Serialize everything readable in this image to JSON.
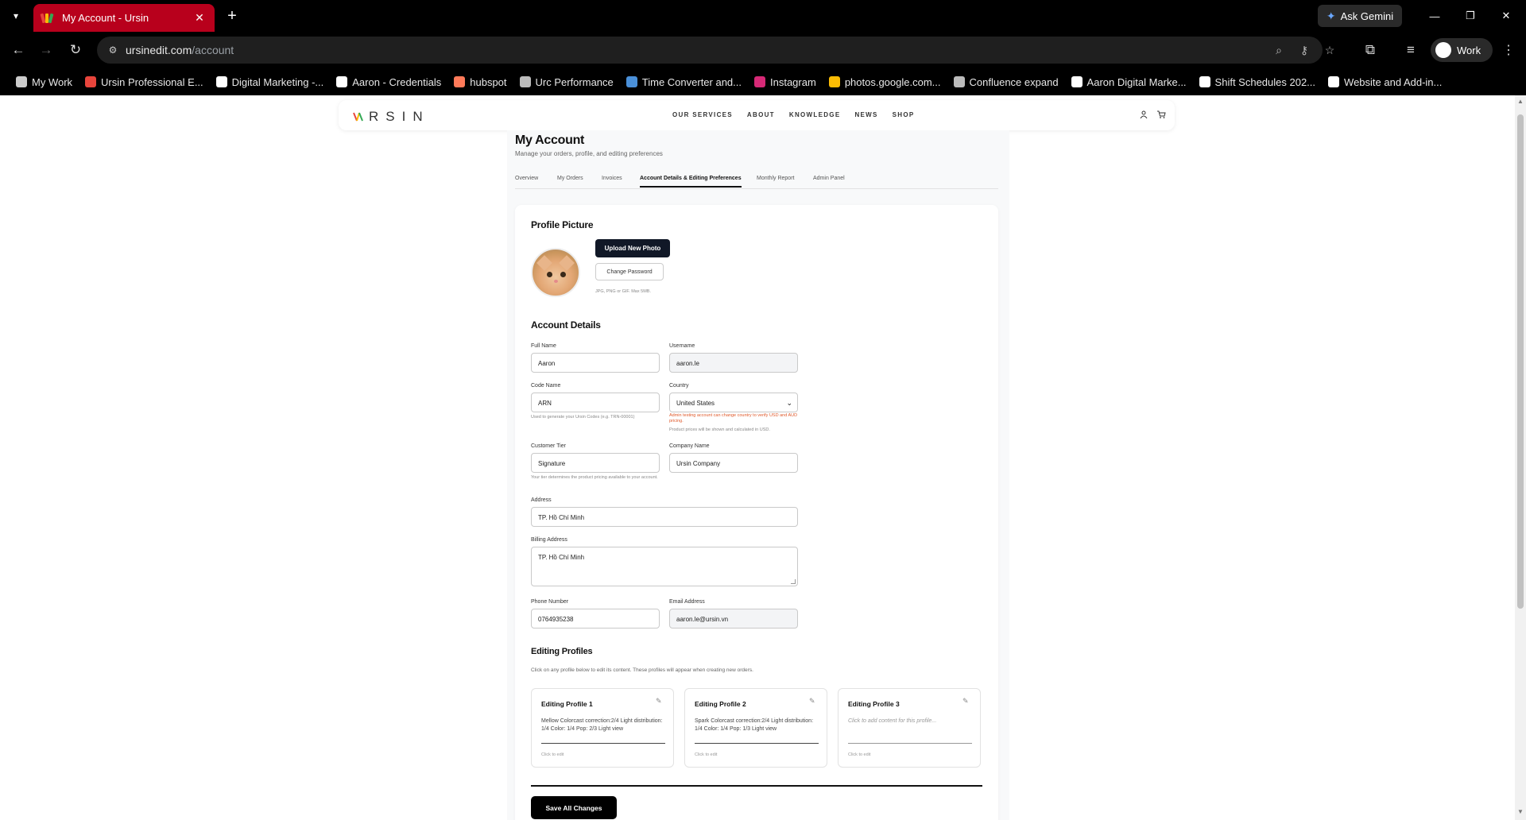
{
  "browser": {
    "tab_title": "My Account - Ursin",
    "ask_gemini": "Ask Gemini",
    "url_host": "ursinedit.com",
    "url_path": "/account",
    "profile_name": "Work",
    "bookmarks": [
      {
        "label": "My Work",
        "color": "#cccccc"
      },
      {
        "label": "Ursin Professional E...",
        "color": "#e8453c"
      },
      {
        "label": "Digital Marketing -...",
        "color": "#ffffff"
      },
      {
        "label": "Aaron - Credentials",
        "color": "#ffffff"
      },
      {
        "label": "hubspot",
        "color": "#ff7a59"
      },
      {
        "label": "Urc Performance",
        "color": "#bbbbbb"
      },
      {
        "label": "Time Converter and...",
        "color": "#4a90d9"
      },
      {
        "label": "Instagram",
        "color": "#d62976"
      },
      {
        "label": "photos.google.com...",
        "color": "#fbbc04"
      },
      {
        "label": "Confluence expand",
        "color": "#bbbbbb"
      },
      {
        "label": "Aaron Digital Marke...",
        "color": "#ffffff"
      },
      {
        "label": "Shift Schedules 202...",
        "color": "#ffffff"
      },
      {
        "label": "Website and Add-in...",
        "color": "#ffffff"
      }
    ]
  },
  "site": {
    "logo_text": "RSIN",
    "nav": [
      "OUR SERVICES",
      "ABOUT",
      "KNOWLEDGE",
      "NEWS",
      "SHOP"
    ]
  },
  "page": {
    "title": "My Account",
    "subtitle": "Manage your orders, profile, and editing preferences",
    "tabs": [
      "Overview",
      "My Orders",
      "Invoices",
      "Account Details & Editing Preferences",
      "Monthly Report",
      "Admin Panel"
    ],
    "active_tab": "Account Details & Editing Preferences"
  },
  "profile_picture": {
    "heading": "Profile Picture",
    "upload_label": "Upload New Photo",
    "change_password_label": "Change Password",
    "hint": "JPG, PNG or GIF. Max 5MB."
  },
  "account": {
    "heading": "Account Details",
    "full_name_label": "Full Name",
    "full_name": "Aaron",
    "username_label": "Username",
    "username": "aaron.le",
    "code_name_label": "Code Name",
    "code_name": "ARN",
    "code_name_hint": "Used to generate your Ursin Codes (e.g. TRN-00001)",
    "country_label": "Country",
    "country": "United States",
    "country_warn": "Admin testing account can change country to verify USD and AUD pricing.",
    "country_hint": "Product prices will be shown and calculated in USD.",
    "tier_label": "Customer Tier",
    "tier": "Signature",
    "tier_hint": "Your tier determines the product pricing available to your account.",
    "company_label": "Company Name",
    "company": "Ursin Company",
    "address_label": "Address",
    "address": "TP. Hồ Chí Minh",
    "billing_label": "Billing Address",
    "billing": "TP. Hồ Chí Minh",
    "phone_label": "Phone Number",
    "phone": "0764935238",
    "email_label": "Email Address",
    "email": "aaron.le@ursin.vn"
  },
  "editing": {
    "heading": "Editing Profiles",
    "description": "Click on any profile below to edit its content. These profiles will appear when creating new orders.",
    "profiles": [
      {
        "title": "Editing Profile 1",
        "content": "Mellow Colorcast correction:2/4 Light distribution: 1/4 Color: 1/4 Pop: 2/3 Light view",
        "footer": "Click to edit"
      },
      {
        "title": "Editing Profile 2",
        "content": "Spark Colorcast correction:2/4 Light distribution: 1/4 Color: 1/4 Pop: 1/3 Light view",
        "footer": "Click to edit"
      },
      {
        "title": "Editing Profile 3",
        "content": "Click to add content for this profile...",
        "footer": "Click to edit"
      }
    ],
    "save_label": "Save All Changes"
  }
}
